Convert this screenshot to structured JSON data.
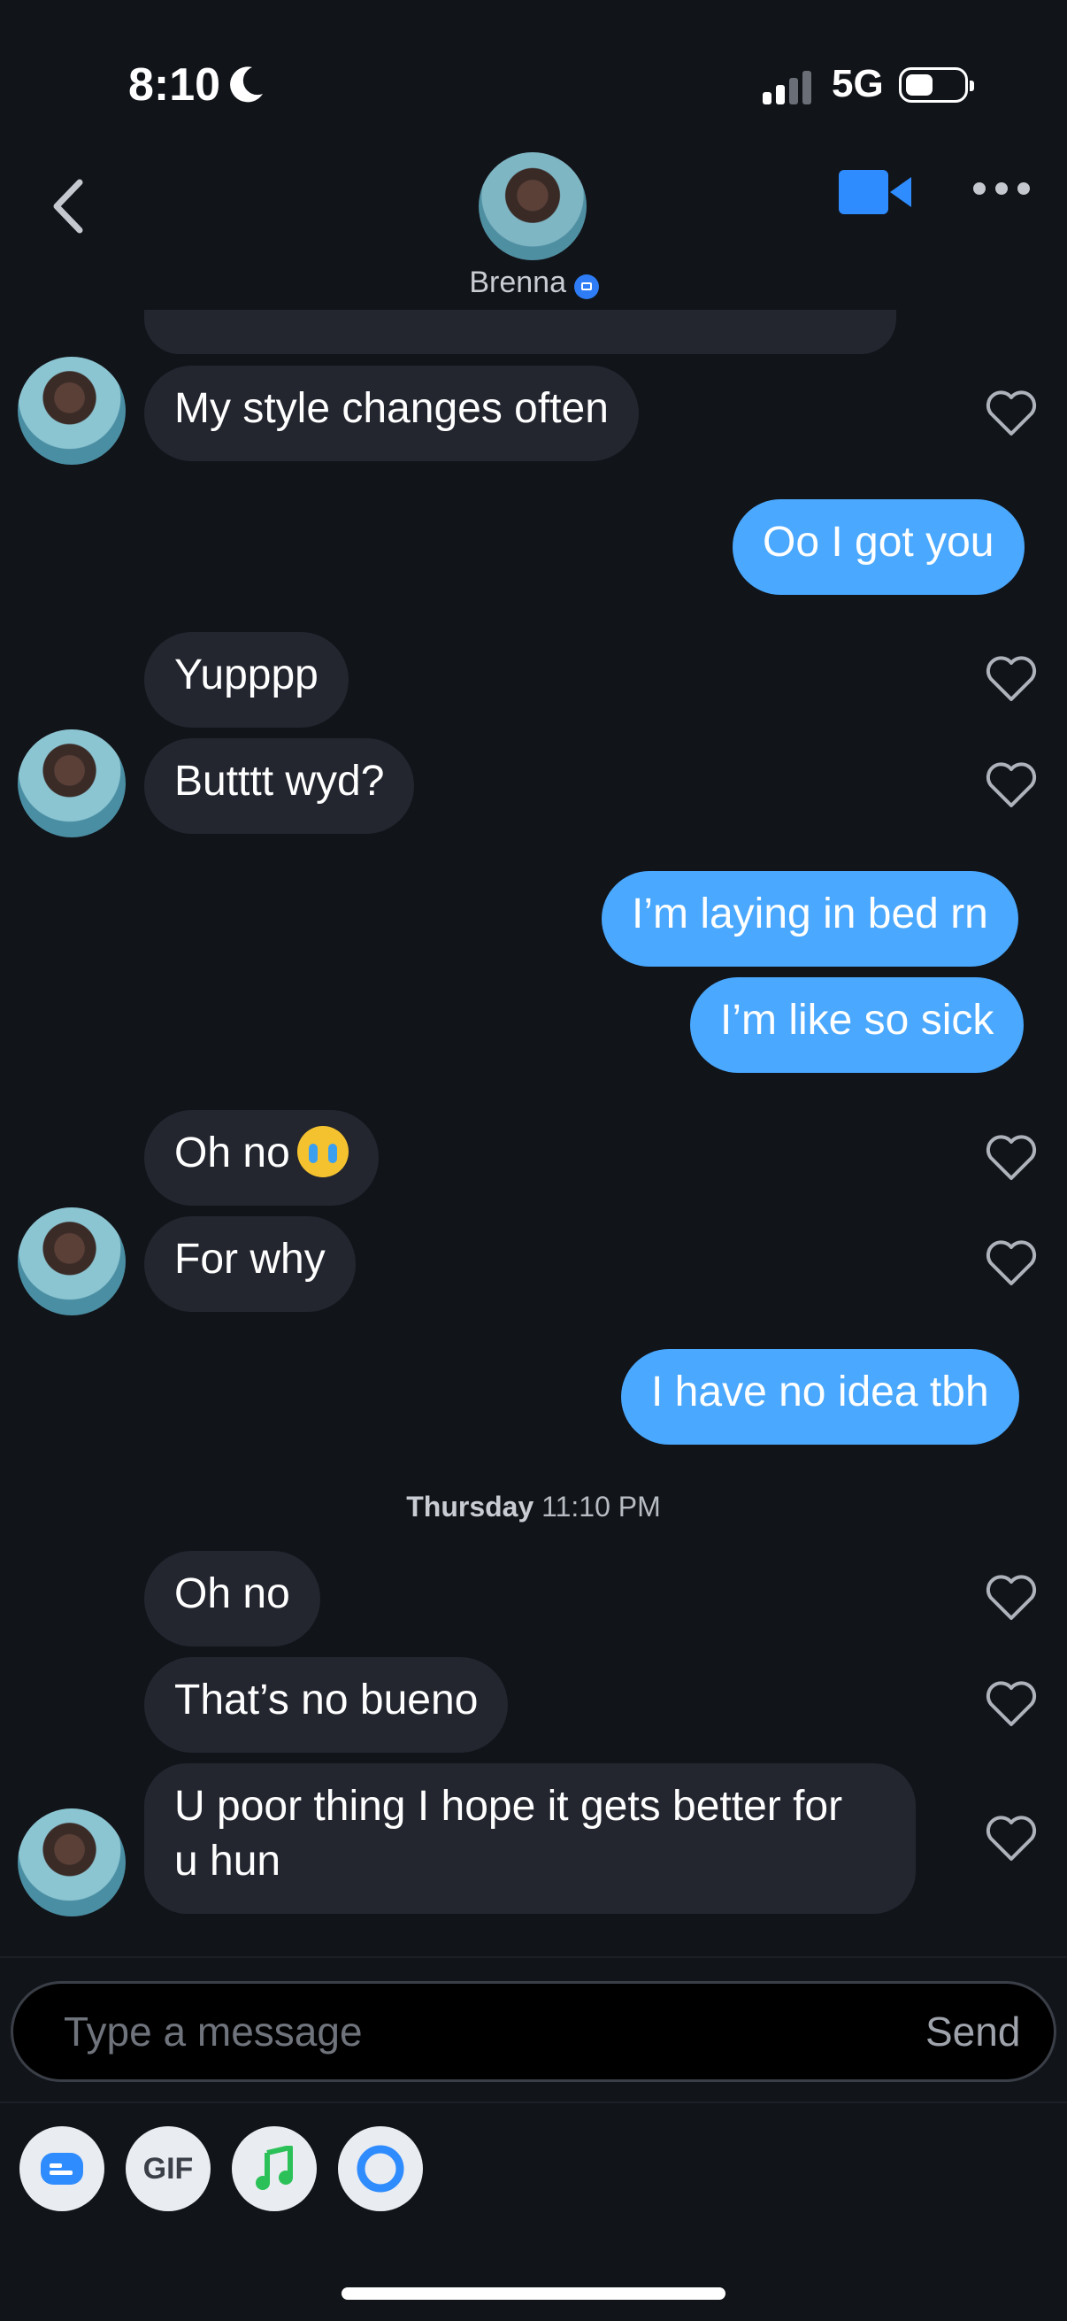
{
  "status_bar": {
    "time": "8:10",
    "network": "5G"
  },
  "header": {
    "contact_name": "Brenna"
  },
  "messages": [
    {
      "text": "My style changes often"
    },
    {
      "text": "Oo I got you"
    },
    {
      "text": "Yupppp"
    },
    {
      "text": "Butttt wyd?"
    },
    {
      "text": "I’m laying in bed rn"
    },
    {
      "text": "I’m like so sick"
    },
    {
      "text": "Oh no"
    },
    {
      "text": "For why"
    },
    {
      "text": "I have no idea tbh"
    },
    {
      "text": "Oh no"
    },
    {
      "text": "That’s no bueno"
    },
    {
      "text_line1": "U poor thing I hope it gets better for",
      "text_line2": "u hun"
    }
  ],
  "timestamp": {
    "day": "Thursday",
    "time": "11:10 PM"
  },
  "composer": {
    "placeholder": "Type a message",
    "send_label": "Send"
  },
  "toolbar": {
    "gif_label": "GIF"
  },
  "colors": {
    "outgoing": "#4aa8ff",
    "incoming": "#23262f",
    "background": "#111419",
    "verified": "#2e7df6"
  }
}
